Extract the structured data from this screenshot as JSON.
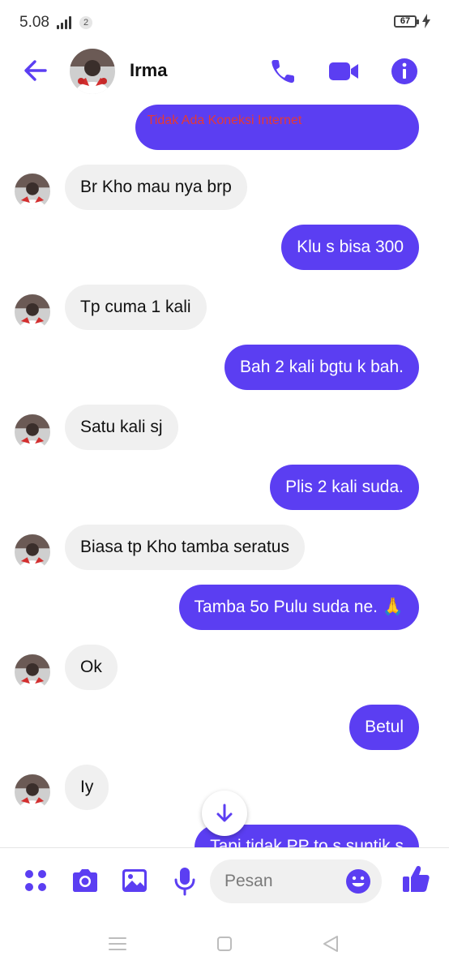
{
  "status_bar": {
    "time": "5.08",
    "notification_count": "2",
    "battery": "67"
  },
  "header": {
    "contact_name": "Irma"
  },
  "banner": {
    "text": "Tidak Ada Koneksi Internet"
  },
  "messages": [
    {
      "from": "contact",
      "text": "Br Kho mau nya brp"
    },
    {
      "from": "me",
      "text": "Klu s bisa 300"
    },
    {
      "from": "contact",
      "text": "Tp cuma 1 kali"
    },
    {
      "from": "me",
      "text": "Bah 2 kali bgtu k bah."
    },
    {
      "from": "contact",
      "text": "Satu kali sj"
    },
    {
      "from": "me",
      "text": "Plis 2 kali suda."
    },
    {
      "from": "contact",
      "text": "Biasa tp Kho tamba seratus"
    },
    {
      "from": "me",
      "text": "Tamba 5o Pulu suda ne. 🙏"
    },
    {
      "from": "contact",
      "text": "Ok"
    },
    {
      "from": "me",
      "text": "Betul"
    },
    {
      "from": "contact",
      "text": "Iy"
    },
    {
      "from": "me",
      "text": "Tapi tidak PP to s suntik s"
    }
  ],
  "composer": {
    "placeholder": "Pesan"
  },
  "icons": {
    "back": "arrow-left-icon",
    "call": "phone-icon",
    "video": "video-camera-icon",
    "info": "info-icon",
    "more": "four-dots-icon",
    "camera": "camera-icon",
    "gallery": "image-icon",
    "mic": "microphone-icon",
    "emoji": "smiley-icon",
    "like": "thumbs-up-icon",
    "scroll": "arrow-down-icon"
  },
  "colors": {
    "accent": "#5b3ef2",
    "incoming_bubble": "#f0f0f0",
    "banner_text": "#e53935"
  }
}
